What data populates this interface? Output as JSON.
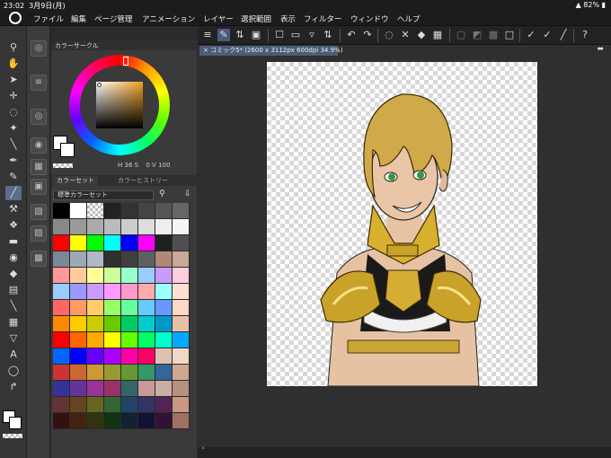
{
  "status": {
    "time": "23:02",
    "date": "3月9日(月)",
    "battery": "82%"
  },
  "menu": [
    "ファイル",
    "編集",
    "ページ管理",
    "アニメーション",
    "レイヤー",
    "選択範囲",
    "表示",
    "フィルター",
    "ウィンドウ",
    "ヘルプ"
  ],
  "panel": {
    "color_circle_title": "カラーサークル",
    "hsv": {
      "h_label": "H",
      "h": "36",
      "s_label": "S",
      "s": "0",
      "v_label": "V",
      "v": "100"
    },
    "color_set_tab": "カラーセット",
    "color_history_tab": "カラーヒストリー",
    "color_set_name": "標準カラーセット",
    "swatches": [
      "#000000",
      "#ffffff",
      "checker",
      "#222222",
      "#333333",
      "#444444",
      "#555555",
      "#666666",
      "#888888",
      "#999999",
      "#aaaaaa",
      "#bbbbbb",
      "#cccccc",
      "#dddddd",
      "#eeeeee",
      "#f5f5f5",
      "#ff0000",
      "#ffff00",
      "#00ff00",
      "#00ffff",
      "#0000ff",
      "#ff00ff",
      "#202020",
      "#505050",
      "#7a8898",
      "#a0a8b8",
      "#b0b8c8",
      "#303030",
      "#404040",
      "#606060",
      "#b08878",
      "#c8a898",
      "#ff9999",
      "#ffcc99",
      "#ffff99",
      "#ccff99",
      "#99ffcc",
      "#99ccff",
      "#cc99ff",
      "#ffccdd",
      "#99ccff",
      "#9999ff",
      "#cc99ff",
      "#ff99ff",
      "#ff99cc",
      "#ffaaaa",
      "#99ffff",
      "#ffe0d0",
      "#ff6666",
      "#ff9966",
      "#ffcc66",
      "#99ff66",
      "#66ff99",
      "#66ccff",
      "#6699ff",
      "#ffd8c8",
      "#ff8800",
      "#ffcc00",
      "#cccc00",
      "#66cc00",
      "#00cc66",
      "#00cccc",
      "#0099cc",
      "#e8c0a8",
      "#ff0000",
      "#ff6600",
      "#ffaa00",
      "#ffff00",
      "#66ff00",
      "#00ff66",
      "#00ffcc",
      "#00aaff",
      "#0066ff",
      "#0000ff",
      "#6600ff",
      "#aa00ff",
      "#ff00aa",
      "#ff0066",
      "#e0c0b0",
      "#f0d8c8",
      "#cc3333",
      "#cc6633",
      "#cc9933",
      "#999933",
      "#669933",
      "#339966",
      "#336699",
      "#d0a890",
      "#333399",
      "#663399",
      "#993399",
      "#993366",
      "#336666",
      "#cc9999",
      "#c8b0a0",
      "#b89080",
      "#663333",
      "#664422",
      "#666622",
      "#336633",
      "#224466",
      "#333366",
      "#552255",
      "#c89880",
      "#331111",
      "#442211",
      "#333311",
      "#113311",
      "#112233",
      "#111133",
      "#331133",
      "#a07060"
    ]
  },
  "doc": {
    "tab": "コミック5* (2600 x 3112px 600dpi 34.9%)"
  }
}
